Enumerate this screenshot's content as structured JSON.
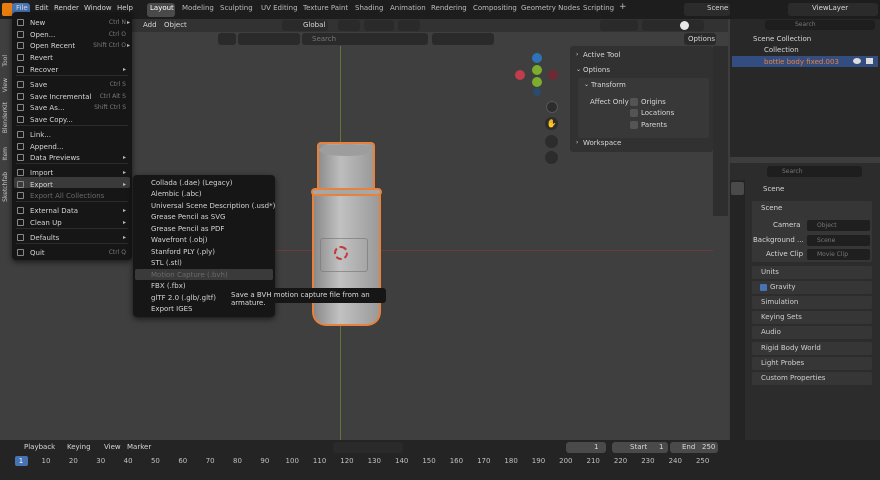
{
  "menus": [
    "File",
    "Edit",
    "Render",
    "Window",
    "Help"
  ],
  "workspaces": [
    "Layout",
    "Modeling",
    "Sculpting",
    "UV Editing",
    "Texture Paint",
    "Shading",
    "Animation",
    "Rendering",
    "Compositing",
    "Geometry Nodes",
    "Scripting"
  ],
  "add_workspace": "+",
  "scene_label": "Scene",
  "viewlayer_label": "ViewLayer",
  "viewport": {
    "menu_add": "Add",
    "menu_object": "Object",
    "orientation": "Global",
    "search_placeholder": "Search",
    "options": "Options"
  },
  "file_menu": {
    "items": [
      {
        "label": "New",
        "shortcut": "Ctrl N",
        "arrow": "▸"
      },
      {
        "label": "Open...",
        "shortcut": "Ctrl O"
      },
      {
        "label": "Open Recent",
        "shortcut": "Shift Ctrl O",
        "arrow": "▸"
      },
      {
        "label": "Revert",
        "shortcut": ""
      },
      {
        "label": "Recover",
        "shortcut": "",
        "arrow": "▸"
      },
      {
        "label": "Save",
        "shortcut": "Ctrl S"
      },
      {
        "label": "Save Incremental",
        "shortcut": "Ctrl Alt S"
      },
      {
        "label": "Save As...",
        "shortcut": "Shift Ctrl S"
      },
      {
        "label": "Save Copy...",
        "shortcut": ""
      },
      {
        "label": "Link...",
        "shortcut": ""
      },
      {
        "label": "Append...",
        "shortcut": ""
      },
      {
        "label": "Data Previews",
        "shortcut": "",
        "arrow": "▸"
      },
      {
        "label": "Import",
        "shortcut": "",
        "arrow": "▸"
      },
      {
        "label": "Export",
        "shortcut": "",
        "arrow": "▸"
      },
      {
        "label": "Export All Collections",
        "shortcut": ""
      },
      {
        "label": "External Data",
        "shortcut": "",
        "arrow": "▸"
      },
      {
        "label": "Clean Up",
        "shortcut": "",
        "arrow": "▸"
      },
      {
        "label": "Defaults",
        "shortcut": "",
        "arrow": "▸"
      },
      {
        "label": "Quit",
        "shortcut": "Ctrl Q"
      }
    ]
  },
  "export_menu": {
    "items": [
      "Collada (.dae) (Legacy)",
      "Alembic (.abc)",
      "Universal Scene Description (.usd*)",
      "Grease Pencil as SVG",
      "Grease Pencil as PDF",
      "Wavefront (.obj)",
      "Stanford PLY (.ply)",
      "STL (.stl)",
      "Motion Capture (.bvh)",
      "FBX (.fbx)",
      "glTF 2.0 (.glb/.gltf)",
      "Export IGES"
    ]
  },
  "tooltip": "Save a BVH motion capture file from an armature.",
  "npanel": {
    "active_tool": "Active Tool",
    "options": "Options",
    "transform": "Transform",
    "affect_only": "Affect Only",
    "origins": "Origins",
    "locations": "Locations",
    "parents": "Parents",
    "workspace": "Workspace"
  },
  "ntabs": [
    "Tool",
    "View",
    "BlenderKit",
    "Item",
    "Sketchfab"
  ],
  "outliner": {
    "search_placeholder": "Search",
    "scene_collection": "Scene Collection",
    "collection": "Collection",
    "object": "bottle body fixed.003"
  },
  "properties": {
    "search_placeholder": "Search",
    "scene_title": "Scene",
    "section_scene": "Scene",
    "camera_label": "Camera",
    "camera_placeholder": "Object",
    "background_label": "Background ...",
    "background_placeholder": "Scene",
    "active_clip_label": "Active Clip",
    "active_clip_placeholder": "Movie Clip",
    "sections": [
      "Units",
      "Gravity",
      "Simulation",
      "Keying Sets",
      "Audio",
      "Rigid Body World",
      "Light Probes",
      "Custom Properties"
    ]
  },
  "timeline": {
    "menus": [
      "Playback",
      "Keying",
      "View",
      "Marker"
    ],
    "current_frame": "1",
    "start_label": "Start",
    "start": "1",
    "end_label": "End",
    "end": "250",
    "ticks": [
      "1",
      "10",
      "20",
      "30",
      "40",
      "50",
      "60",
      "70",
      "80",
      "90",
      "100",
      "110",
      "120",
      "130",
      "140",
      "150",
      "160",
      "170",
      "180",
      "190",
      "200",
      "210",
      "220",
      "230",
      "240",
      "250"
    ]
  },
  "colors": {
    "accent": "#4772b3",
    "selection": "#e8813b",
    "header": "#1d1d1d",
    "menu_bg": "#161616"
  }
}
